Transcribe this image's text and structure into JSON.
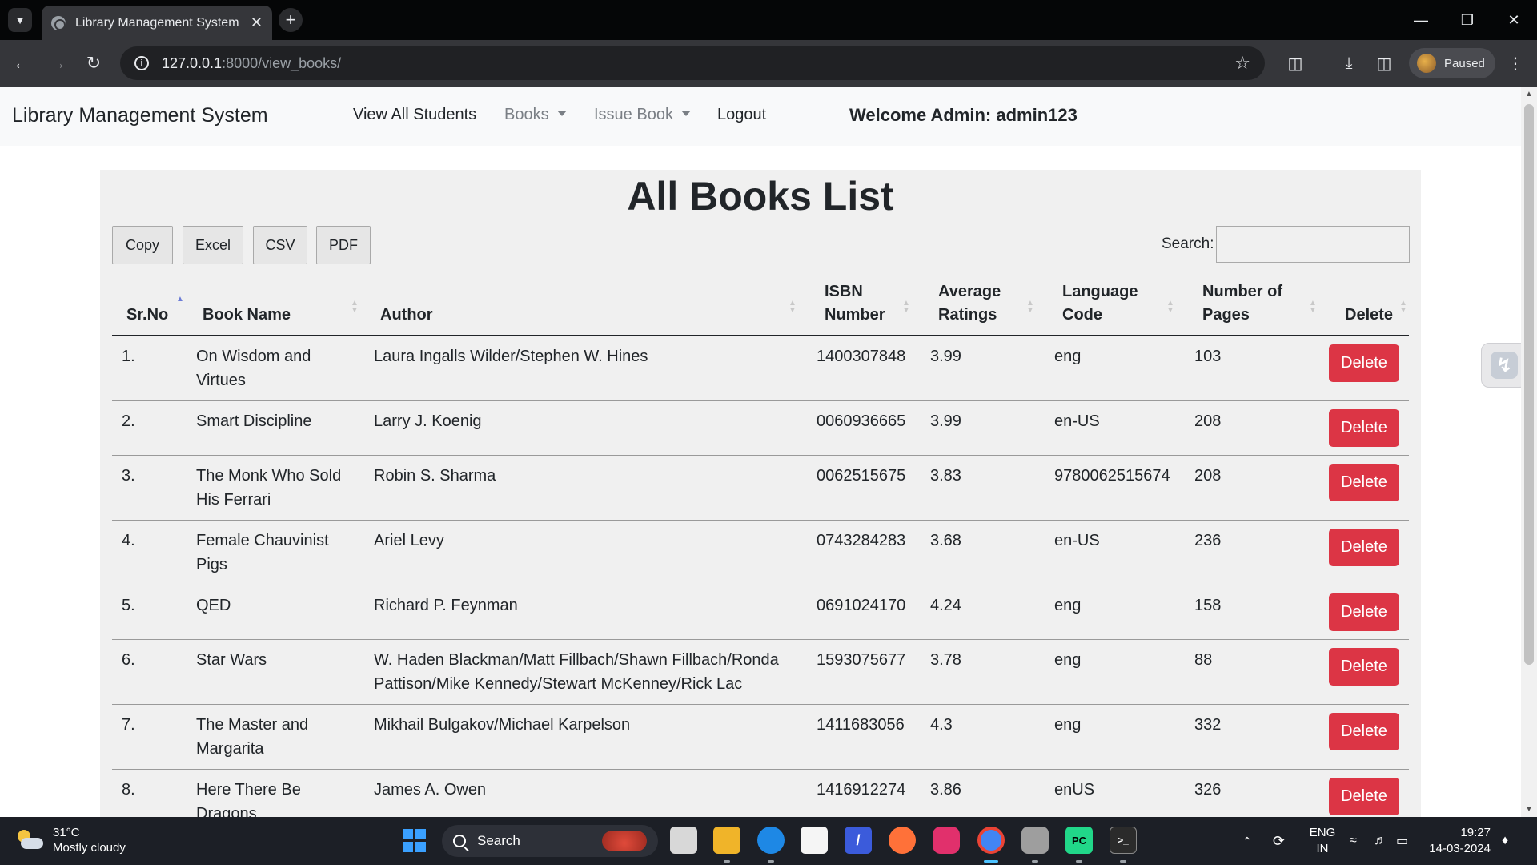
{
  "browser": {
    "tab_title": "Library Management System",
    "url_host": "127.0.0.1",
    "url_path": ":8000/view_books/",
    "profile_status": "Paused"
  },
  "navbar": {
    "brand": "Library Management System",
    "links": [
      {
        "label": "View All Students"
      },
      {
        "label": "Books"
      },
      {
        "label": "Issue Book"
      },
      {
        "label": "Logout"
      }
    ],
    "welcome": "Welcome Admin: admin123"
  },
  "page": {
    "title": "All Books List",
    "export_buttons": [
      "Copy",
      "Excel",
      "CSV",
      "PDF"
    ],
    "search_label": "Search:",
    "search_value": ""
  },
  "table": {
    "columns": [
      {
        "line1": "",
        "line2": "Sr.No"
      },
      {
        "line1": "",
        "line2": "Book Name"
      },
      {
        "line1": "",
        "line2": "Author"
      },
      {
        "line1": "ISBN",
        "line2": "Number"
      },
      {
        "line1": "Average",
        "line2": "Ratings"
      },
      {
        "line1": "Language",
        "line2": "Code"
      },
      {
        "line1": "Number of",
        "line2": "Pages"
      },
      {
        "line1": "",
        "line2": "Delete"
      }
    ],
    "delete_label": "Delete",
    "rows": [
      {
        "sr": "1.",
        "name": [
          "On Wisdom and",
          "Virtues"
        ],
        "author": [
          "Laura Ingalls Wilder/Stephen W. Hines"
        ],
        "isbn": "1400307848",
        "rating": "3.99",
        "lang": "eng",
        "pages": "103"
      },
      {
        "sr": "2.",
        "name": [
          "Smart Discipline"
        ],
        "author": [
          "Larry J. Koenig"
        ],
        "isbn": "0060936665",
        "rating": "3.99",
        "lang": "en-US",
        "pages": "208"
      },
      {
        "sr": "3.",
        "name": [
          "The Monk Who Sold",
          "His Ferrari"
        ],
        "author": [
          "Robin S. Sharma"
        ],
        "isbn": "0062515675",
        "rating": "3.83",
        "lang": "9780062515674",
        "pages": "208"
      },
      {
        "sr": "4.",
        "name": [
          "Female Chauvinist",
          "Pigs"
        ],
        "author": [
          "Ariel Levy"
        ],
        "isbn": "0743284283",
        "rating": "3.68",
        "lang": "en-US",
        "pages": "236"
      },
      {
        "sr": "5.",
        "name": [
          "QED"
        ],
        "author": [
          "Richard P. Feynman"
        ],
        "isbn": "0691024170",
        "rating": "4.24",
        "lang": "eng",
        "pages": "158"
      },
      {
        "sr": "6.",
        "name": [
          "Star Wars"
        ],
        "author": [
          "W. Haden Blackman/Matt Fillbach/Shawn Fillbach/Ronda",
          "Pattison/Mike Kennedy/Stewart McKenney/Rick Lac"
        ],
        "isbn": "1593075677",
        "rating": "3.78",
        "lang": "eng",
        "pages": "88"
      },
      {
        "sr": "7.",
        "name": [
          "The Master and",
          "Margarita"
        ],
        "author": [
          "Mikhail Bulgakov/Michael Karpelson"
        ],
        "isbn": "1411683056",
        "rating": "4.3",
        "lang": "eng",
        "pages": "332"
      },
      {
        "sr": "8.",
        "name": [
          "Here There Be",
          "Dragons"
        ],
        "author": [
          "James A. Owen"
        ],
        "isbn": "1416912274",
        "rating": "3.86",
        "lang": "enUS",
        "pages": "326"
      }
    ]
  },
  "taskbar": {
    "temperature": "31°C",
    "weather": "Mostly cloudy",
    "search_label": "Search",
    "lang_line1": "ENG",
    "lang_line2": "IN",
    "time": "19:27",
    "date": "14-03-2024"
  },
  "colors": {
    "danger": "#dc3545",
    "panel_bg": "#f0f0f0",
    "navbar_bg": "#f8f9fa",
    "sort_active": "#6c7cd6"
  }
}
